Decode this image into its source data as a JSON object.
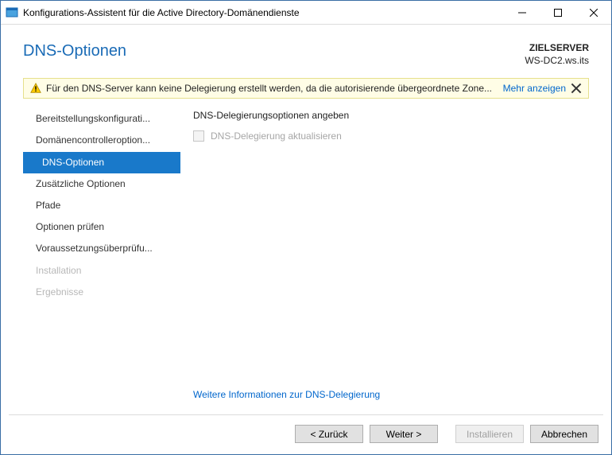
{
  "window": {
    "title": "Konfigurations-Assistent für die Active Directory-Domänendienste"
  },
  "header": {
    "page_title": "DNS-Optionen",
    "target_label": "ZIELSERVER",
    "target_value": "WS-DC2.ws.its"
  },
  "alert": {
    "text": "Für den DNS-Server kann keine Delegierung erstellt werden, da die autorisierende übergeordnete Zone...",
    "more": "Mehr anzeigen"
  },
  "sidebar": {
    "items": [
      {
        "label": "Bereitstellungskonfigurati...",
        "state": "normal"
      },
      {
        "label": "Domänencontrolleroption...",
        "state": "normal"
      },
      {
        "label": "DNS-Optionen",
        "state": "active"
      },
      {
        "label": "Zusätzliche Optionen",
        "state": "normal"
      },
      {
        "label": "Pfade",
        "state": "normal"
      },
      {
        "label": "Optionen prüfen",
        "state": "normal"
      },
      {
        "label": "Voraussetzungsüberprüfu...",
        "state": "normal"
      },
      {
        "label": "Installation",
        "state": "disabled"
      },
      {
        "label": "Ergebnisse",
        "state": "disabled"
      }
    ]
  },
  "main": {
    "heading": "DNS-Delegierungsoptionen angeben",
    "checkbox_label": "DNS-Delegierung aktualisieren",
    "checkbox_checked": false,
    "checkbox_enabled": false,
    "footer_link": "Weitere Informationen zur DNS-Delegierung"
  },
  "buttons": {
    "back": "< Zurück",
    "next": "Weiter >",
    "install": "Installieren",
    "cancel": "Abbrechen",
    "install_enabled": false
  }
}
